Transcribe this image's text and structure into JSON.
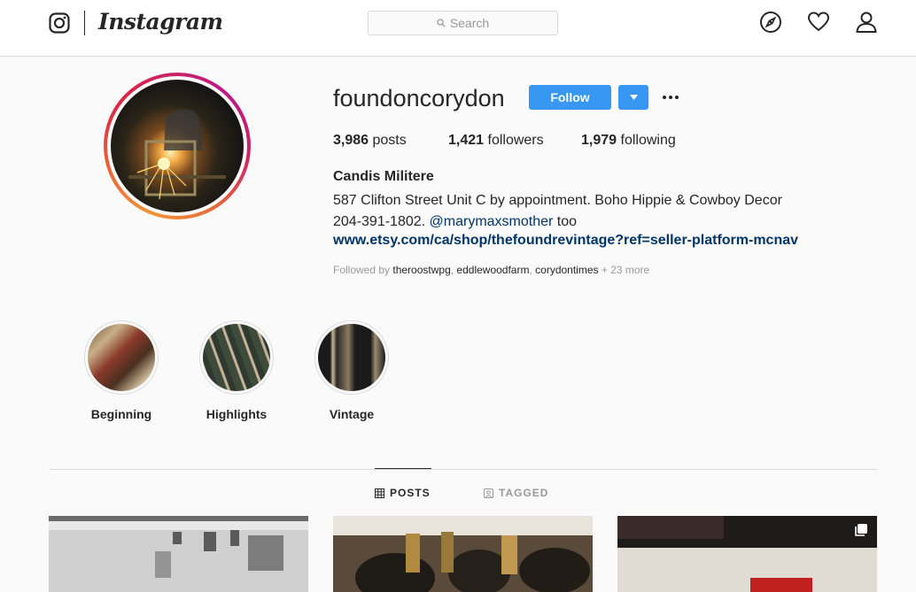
{
  "header": {
    "wordmark": "Instagram",
    "search_placeholder": "Search"
  },
  "profile": {
    "username": "foundoncorydon",
    "follow_label": "Follow",
    "stats": {
      "posts_count": "3,986",
      "posts_label": "posts",
      "followers_count": "1,421",
      "followers_label": "followers",
      "following_count": "1,979",
      "following_label": "following"
    },
    "full_name": "Candis Militere",
    "bio_line1": "587 Clifton Street Unit C by appointment. Boho Hippie & Cowboy Decor",
    "bio_line2_prefix": "204-391-1802. ",
    "bio_mention": "@marymaxsmother",
    "bio_line2_suffix": " too",
    "website": "www.etsy.com/ca/shop/thefoundrevintage?ref=seller-platform-mcnav",
    "followed_by_prefix": "Followed by ",
    "followed_by_1": "theroostwpg",
    "followed_by_sep1": ", ",
    "followed_by_2": "eddlewoodfarm",
    "followed_by_sep2": ", ",
    "followed_by_3": "corydontimes",
    "followed_by_more": " + 23 more"
  },
  "highlights": [
    {
      "label": "Beginning"
    },
    {
      "label": "Highlights"
    },
    {
      "label": "Vintage"
    }
  ],
  "tabs": {
    "posts": "POSTS",
    "tagged": "TAGGED"
  },
  "colors": {
    "accent": "#3897f0",
    "link": "#003569",
    "muted": "#999999",
    "border": "#dbdbdb"
  },
  "icons": [
    "instagram-glyph-icon",
    "search-icon",
    "compass-icon",
    "heart-icon",
    "user-icon",
    "caret-down-icon",
    "more-dots-icon",
    "grid-icon",
    "tag-portrait-icon",
    "multiple-posts-icon"
  ]
}
